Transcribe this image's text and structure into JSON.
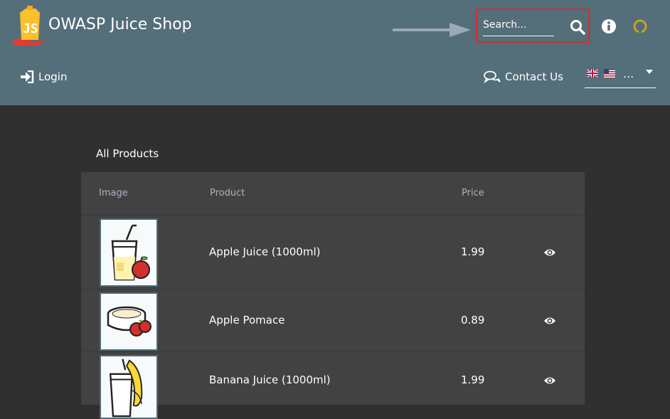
{
  "header": {
    "app_title": "OWASP Juice Shop",
    "search_placeholder": "Search...",
    "icons": {
      "logo": "juice-shop-logo",
      "search": "search-icon",
      "info": "info-icon",
      "github": "github-icon",
      "annotation": "arrow-icon"
    },
    "colors": {
      "toolbar": "#546e7a",
      "highlight_border": "#d32f2f",
      "github_icon": "#c9a227"
    }
  },
  "nav": {
    "login_label": "Login",
    "contact_label": "Contact Us",
    "language_value": "..."
  },
  "main": {
    "title": "All Products",
    "columns": [
      "Image",
      "Product",
      "Price"
    ],
    "products": [
      {
        "name": "Apple Juice (1000ml)",
        "price": "1.99",
        "image": "apple-juice-image"
      },
      {
        "name": "Apple Pomace",
        "price": "0.89",
        "image": "apple-pomace-image"
      },
      {
        "name": "Banana Juice (1000ml)",
        "price": "1.99",
        "image": "banana-juice-image"
      }
    ]
  }
}
